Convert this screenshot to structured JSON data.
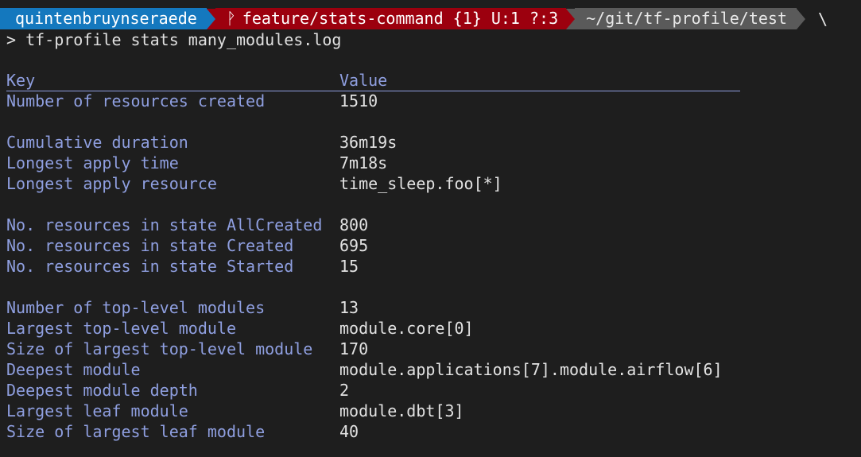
{
  "prompt": {
    "user": "quintenbruynseraede",
    "branch": "feature/stats-command {1} U:1 ?:3",
    "path": "~/git/tf-profile/test",
    "continuation": "\\",
    "branch_icon": "git-branch-icon",
    "colors": {
      "user_bg": "#1478be",
      "git_bg": "#9c000e",
      "path_bg": "#5a5a5a"
    }
  },
  "command": "> tf-profile stats many_modules.log",
  "table": {
    "headers": {
      "key": "Key",
      "value": "Value"
    },
    "rows": [
      {
        "key": "Number of resources created",
        "value": "1510"
      },
      {
        "key": "Cumulative duration",
        "value": "36m19s"
      },
      {
        "key": "Longest apply time",
        "value": "7m18s"
      },
      {
        "key": "Longest apply resource",
        "value": "time_sleep.foo[*]"
      },
      {
        "key": "No. resources in state AllCreated",
        "value": "800"
      },
      {
        "key": "No. resources in state Created",
        "value": "695"
      },
      {
        "key": "No. resources in state Started",
        "value": "15"
      },
      {
        "key": "Number of top-level modules",
        "value": "13"
      },
      {
        "key": "Largest top-level module",
        "value": "module.core[0]"
      },
      {
        "key": "Size of largest top-level module",
        "value": "170"
      },
      {
        "key": "Deepest module",
        "value": "module.applications[7].module.airflow[6]"
      },
      {
        "key": "Deepest module depth",
        "value": "2"
      },
      {
        "key": "Largest leaf module",
        "value": "module.dbt[3]"
      },
      {
        "key": "Size of largest leaf module",
        "value": "40"
      }
    ]
  },
  "colors": {
    "background": "#1e1e1e",
    "key_text": "#8f9fe0",
    "value_text": "#e2e2e2"
  }
}
